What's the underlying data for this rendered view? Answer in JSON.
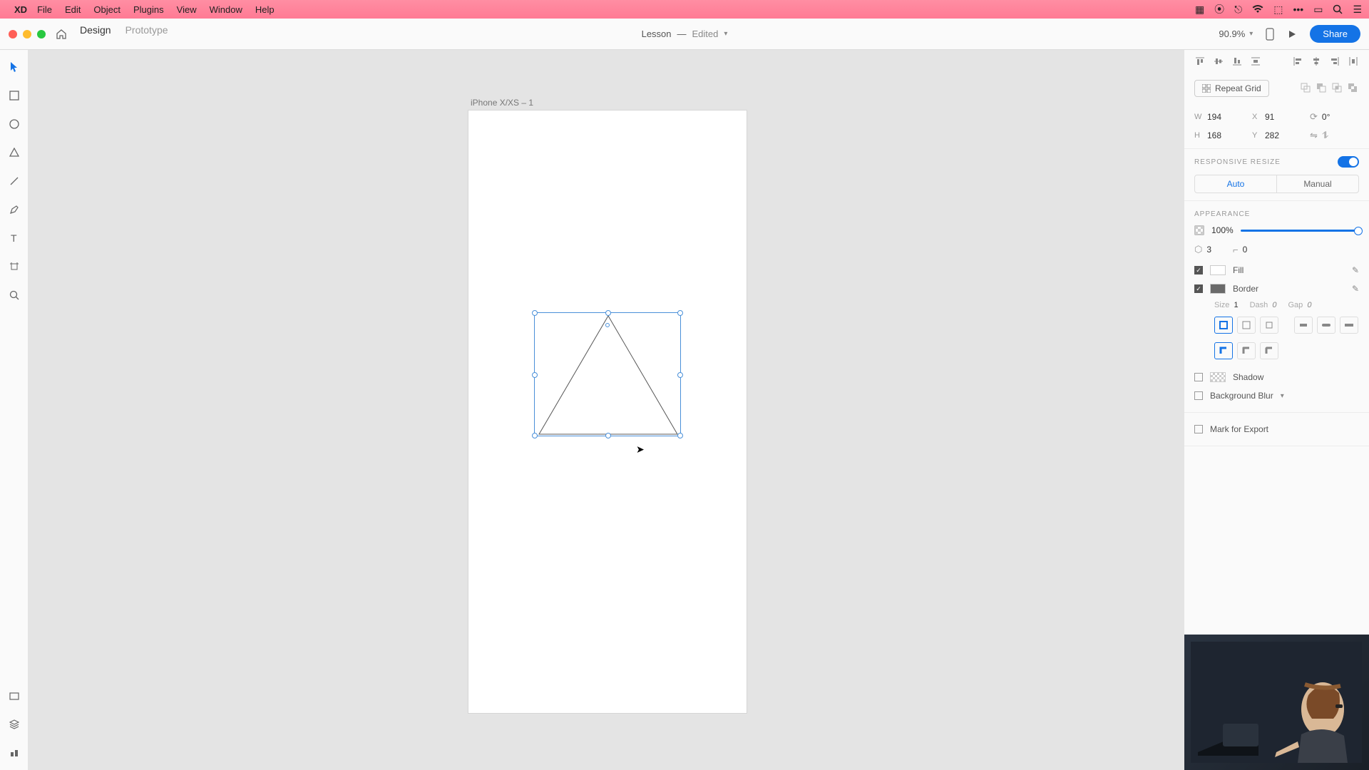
{
  "menubar": {
    "app": "XD",
    "items": [
      "File",
      "Edit",
      "Object",
      "Plugins",
      "View",
      "Window",
      "Help"
    ]
  },
  "toolbar": {
    "modes": {
      "design": "Design",
      "prototype": "Prototype"
    },
    "doc_title": "Lesson",
    "doc_status": "Edited",
    "zoom": "90.9%",
    "share": "Share"
  },
  "canvas": {
    "artboard_label": "iPhone X/XS – 1"
  },
  "panel": {
    "repeat_grid": "Repeat Grid",
    "transform": {
      "w": "194",
      "h": "168",
      "x": "91",
      "y": "282",
      "rot": "0°"
    },
    "responsive": {
      "heading": "RESPONSIVE RESIZE",
      "auto": "Auto",
      "manual": "Manual"
    },
    "appearance": {
      "heading": "APPEARANCE",
      "opacity": "100%",
      "corner_count": "3",
      "corner_radius": "0",
      "fill_label": "Fill",
      "border_label": "Border",
      "stroke": {
        "size_lbl": "Size",
        "size": "1",
        "dash_lbl": "Dash",
        "dash": "0",
        "gap_lbl": "Gap",
        "gap": "0"
      },
      "shadow": "Shadow",
      "bg_blur": "Background Blur"
    },
    "export": "Mark for Export"
  }
}
